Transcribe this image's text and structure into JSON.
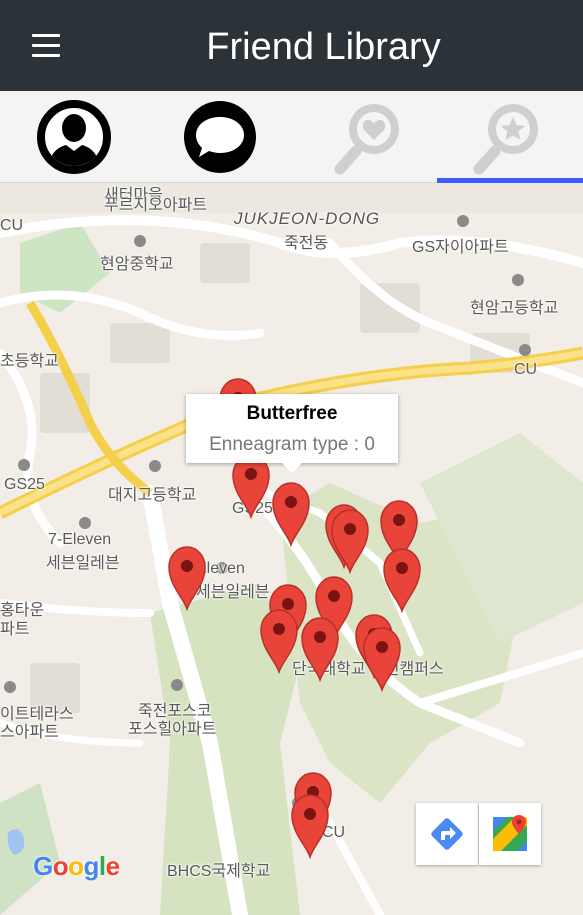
{
  "header": {
    "title": "Friend Library",
    "menu_icon": "hamburger-menu-icon"
  },
  "tabs": [
    {
      "icon": "profile-person-icon",
      "active": false
    },
    {
      "icon": "chat-bubble-icon",
      "active": false
    },
    {
      "icon": "search-heart-icon",
      "active": false
    },
    {
      "icon": "search-star-icon",
      "active": true
    }
  ],
  "colors": {
    "appbar": "#2b3238",
    "tab_indicator": "#3d5afe",
    "marker": "#e8443a"
  },
  "map": {
    "labels": {
      "jukjeon_dong_en": "JUKJEON-DONG",
      "jukjeon_dong_ko": "죽전동",
      "purgio_apt_top": "새터마을",
      "purgio_apt": "푸르지오아파트",
      "hyunam_middle": "현암중학교",
      "gs_xi": "GS자이아파트",
      "hyunam_high": "현암고등학교",
      "cu_right": "CU",
      "elementary_left": "초등학교",
      "gs25_left": "GS25",
      "daeji_high": "대지고등학교",
      "seven_eleven_en": "7-Eleven",
      "seven_eleven_ko": "세븐일레븐",
      "eleven_mid_en": "Eleven",
      "eleven_mid_ko": "세븐일레븐",
      "gs25_mid": "GS25",
      "hongtown_1": "홍타운",
      "hongtown_2": "파트",
      "dankook": "단국대학교 죽전캠퍼스",
      "iterrace_1": "이트테라스",
      "iterrace_2": "스아파트",
      "jukjeon_posco_1": "죽전포스코",
      "jukjeon_posco_2": "포스힐아파트",
      "bhcs": "BHCS국제학교",
      "cu_bottom": "CU",
      "cu_top_left": "CU"
    },
    "info_window": {
      "title": "Butterfree",
      "subtitle": "Enneagram type : 0"
    },
    "google_logo": "Google",
    "directions_icon": "directions-arrow-icon",
    "google_maps_icon": "google-maps-icon"
  }
}
